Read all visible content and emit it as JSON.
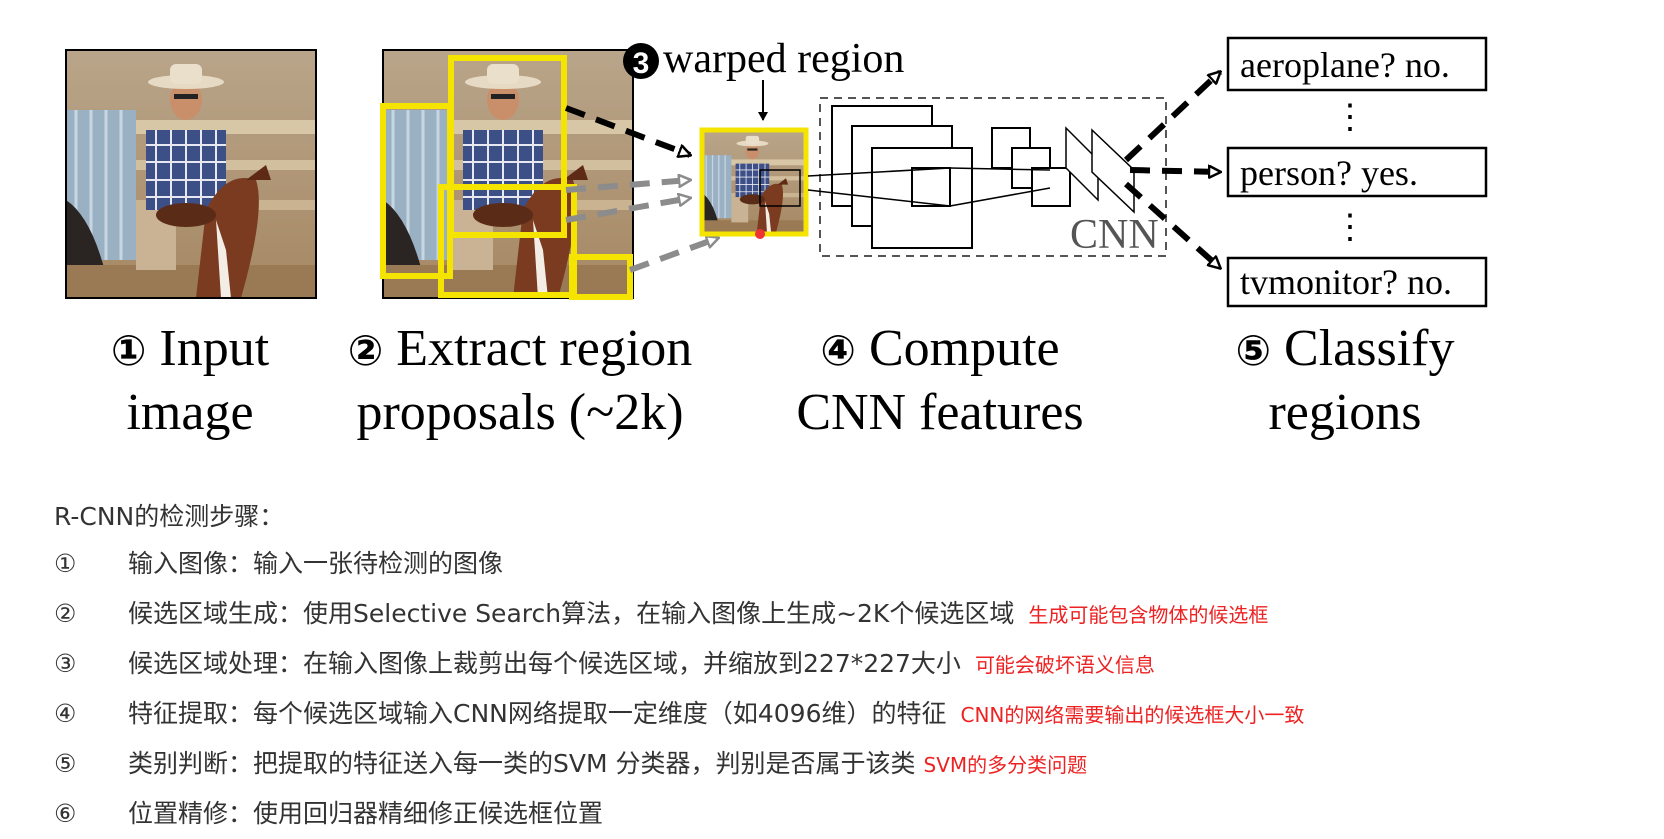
{
  "diagram": {
    "warped_label_num": "3",
    "warped_label": "warped region",
    "cnn_label": "CNN",
    "outputs": [
      "aeroplane? no.",
      "person? yes.",
      "tvmonitor? no."
    ],
    "output_dots": "⋮"
  },
  "captions": [
    {
      "num": "①",
      "line1": "Input",
      "line2": "image"
    },
    {
      "num": "②",
      "line1": "Extract region",
      "line2": "proposals (~2k)"
    },
    {
      "num": "④",
      "line1": "Compute",
      "line2": "CNN features"
    },
    {
      "num": "⑤",
      "line1": "Classify",
      "line2": "regions"
    }
  ],
  "steps_title": "R-CNN的检测步骤：",
  "steps": [
    {
      "num": "①",
      "text": "输入图像：输入一张待检测的图像",
      "note": ""
    },
    {
      "num": "②",
      "text": "候选区域生成：使用Selective Search算法，在输入图像上生成~2K个候选区域",
      "note": "生成可能包含物体的候选框"
    },
    {
      "num": "③",
      "text": "候选区域处理：在输入图像上裁剪出每个候选区域，并缩放到227*227大小",
      "note": "可能会破坏语义信息"
    },
    {
      "num": "④",
      "text": "特征提取：每个候选区域输入CNN网络提取一定维度（如4096维）的特征",
      "note": "CNN的网络需要输出的候选框大小一致"
    },
    {
      "num": "⑤",
      "text": "类别判断：把提取的特征送入每一类的SVM 分类器，判别是否属于该类",
      "note": "SVM的多分类问题"
    },
    {
      "num": "⑥",
      "text": "位置精修：使用回归器精细修正候选框位置",
      "note": ""
    }
  ],
  "colors": {
    "highlight": "#f5e400",
    "note": "#e22222",
    "text": "#333333"
  }
}
